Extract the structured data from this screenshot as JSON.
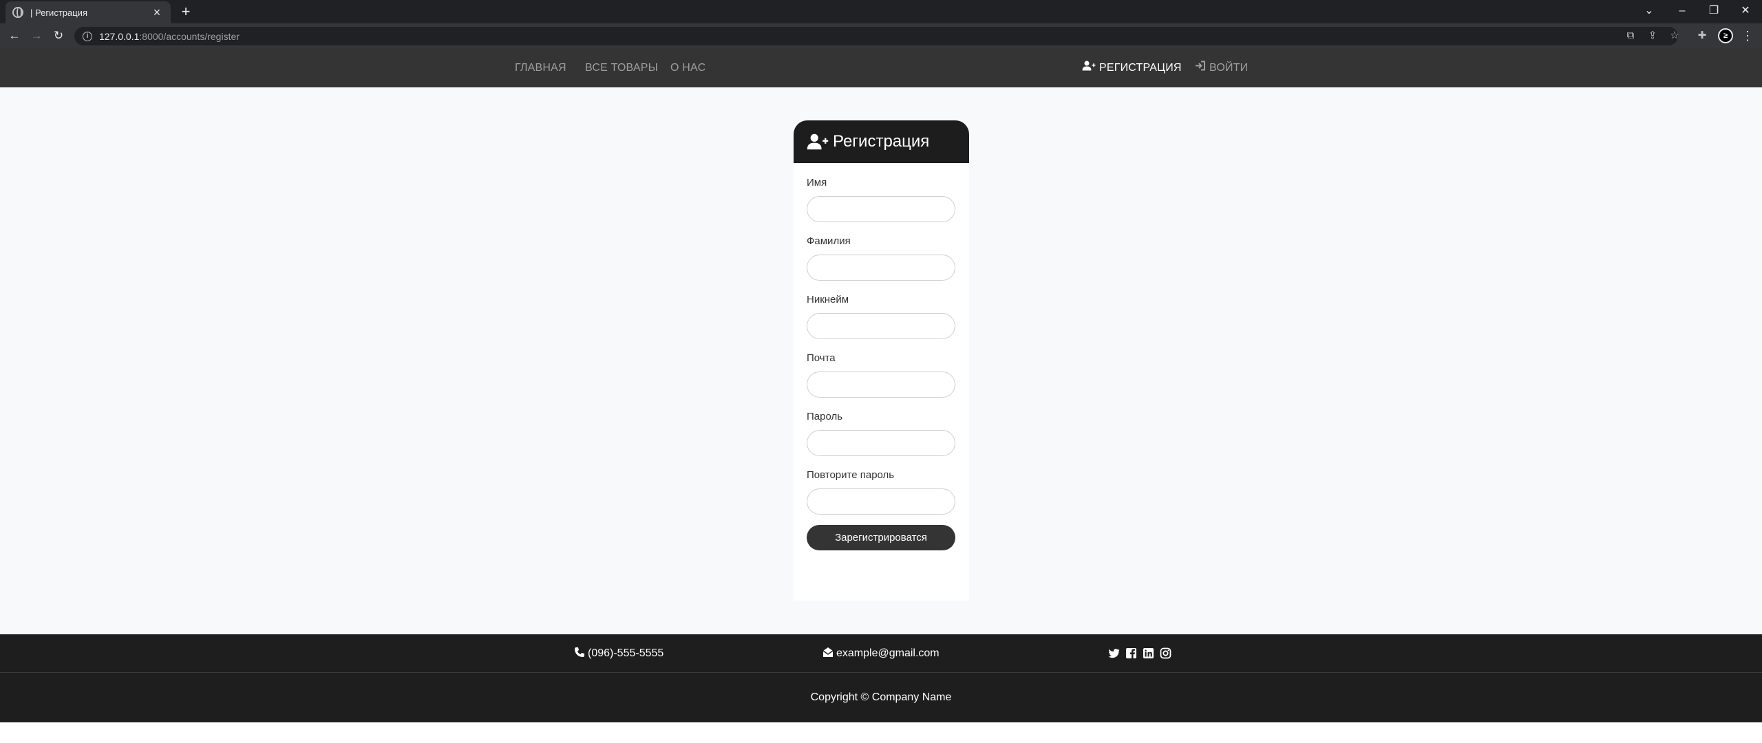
{
  "browser": {
    "tab_title": "| Регистрация",
    "new_tab_icon": "plus-icon",
    "url_host": "127.0.0.1",
    "url_rest": ":8000/accounts/register"
  },
  "nav": {
    "links": [
      "ГЛАВНАЯ",
      "ВСЕ ТОВАРЫ",
      "О НАС"
    ],
    "register": "РЕГИСТРАЦИЯ",
    "login": "ВОЙТИ"
  },
  "form": {
    "title": "Регистрация",
    "fields": [
      {
        "label": "Имя",
        "value": ""
      },
      {
        "label": "Фамилия",
        "value": ""
      },
      {
        "label": "Никнейм",
        "value": ""
      },
      {
        "label": "Почта",
        "value": ""
      },
      {
        "label": "Пароль",
        "value": ""
      },
      {
        "label": "Повторите пароль",
        "value": ""
      }
    ],
    "submit": "Зарегистрироватся"
  },
  "footer": {
    "phone": "(096)-555-5555",
    "email": "example@gmail.com",
    "social_icons": [
      "twitter-icon",
      "facebook-icon",
      "linkedin-icon",
      "instagram-icon"
    ],
    "copyright": "Copyright © Company Name"
  },
  "colors": {
    "navbar": "#343434",
    "card_header": "#1d1d1d",
    "footer": "#1e1e1e",
    "page_bg": "#f8f9fa"
  }
}
